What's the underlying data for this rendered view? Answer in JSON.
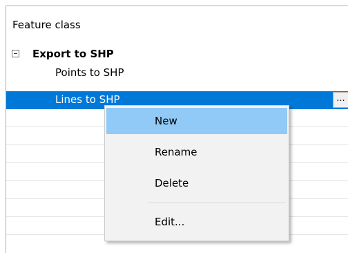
{
  "header": {
    "column_title": "Feature class"
  },
  "tree": {
    "group": {
      "label": "Export to SHP",
      "expanded": true,
      "expander_icon": "minus-box-icon"
    },
    "items": [
      {
        "label": "Points to SHP",
        "selected": false
      },
      {
        "label": "Lines to SHP",
        "selected": true,
        "action_button_label": "..."
      }
    ]
  },
  "context_menu": {
    "items": [
      {
        "label": "New",
        "highlighted": true
      },
      {
        "label": "Rename",
        "highlighted": false
      },
      {
        "label": "Delete",
        "highlighted": false
      },
      {
        "label": "Edit...",
        "highlighted": false
      }
    ]
  },
  "colors": {
    "selection": "#0078d7",
    "menu_highlight": "#91c9f7",
    "menu_background": "#f2f2f2"
  }
}
